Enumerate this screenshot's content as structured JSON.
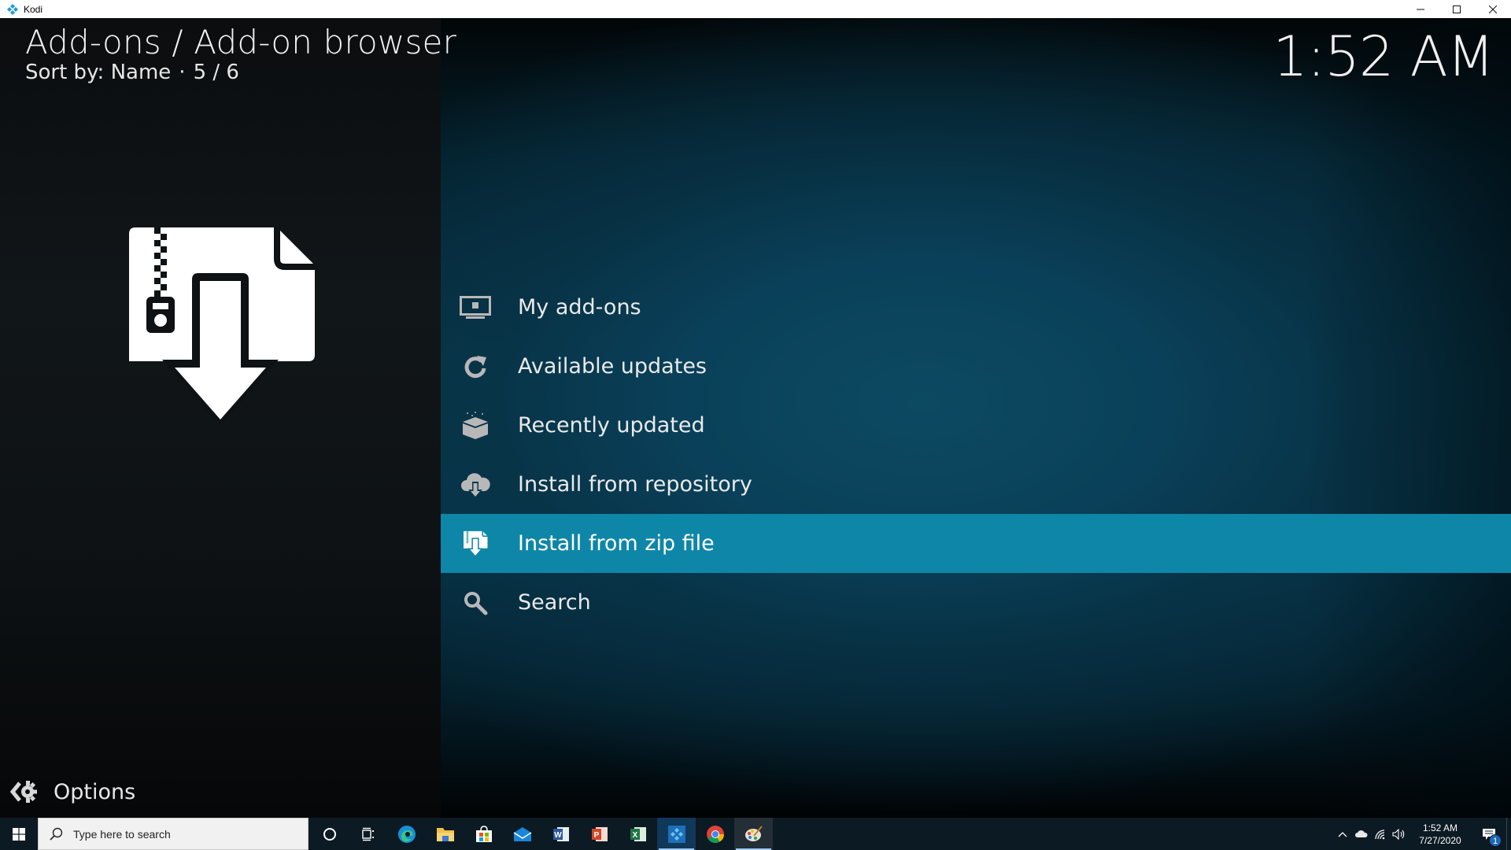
{
  "window": {
    "title": "Kodi",
    "app_icon": "kodi-logo-icon",
    "controls": {
      "minimize": "minimize-icon",
      "maximize": "maximize-icon",
      "close": "close-icon"
    }
  },
  "header": {
    "breadcrumb": "Add-ons / Add-on browser",
    "sort_label": "Sort by: Name",
    "separator": "·",
    "position": "5 / 6",
    "clock": "1:52 AM"
  },
  "preview": {
    "icon": "install-zip-icon"
  },
  "menu": {
    "selected_index": 4,
    "items": [
      {
        "label": "My add-ons",
        "icon": "monitor-addon-icon"
      },
      {
        "label": "Available updates",
        "icon": "refresh-icon"
      },
      {
        "label": "Recently updated",
        "icon": "open-box-icon"
      },
      {
        "label": "Install from repository",
        "icon": "cloud-download-icon"
      },
      {
        "label": "Install from zip file",
        "icon": "zip-download-icon"
      },
      {
        "label": "Search",
        "icon": "search-icon"
      }
    ]
  },
  "options": {
    "label": "Options",
    "icon": "options-gear-icon"
  },
  "colors": {
    "selected_row": "#0e86a8",
    "background_accent": "#0a4059",
    "text": "#eaeaea"
  },
  "taskbar": {
    "search_placeholder": "Type here to search",
    "apps": [
      {
        "name": "cortana",
        "icon": "cortana-icon"
      },
      {
        "name": "task-view",
        "icon": "task-view-icon"
      },
      {
        "name": "edge",
        "icon": "edge-icon"
      },
      {
        "name": "file-explorer",
        "icon": "folder-icon"
      },
      {
        "name": "store",
        "icon": "store-icon"
      },
      {
        "name": "mail",
        "icon": "mail-icon"
      },
      {
        "name": "word",
        "icon": "word-icon"
      },
      {
        "name": "powerpoint",
        "icon": "powerpoint-icon"
      },
      {
        "name": "excel",
        "icon": "excel-icon"
      },
      {
        "name": "kodi",
        "icon": "kodi-icon",
        "state": "active"
      },
      {
        "name": "chrome",
        "icon": "chrome-icon"
      },
      {
        "name": "paint",
        "icon": "paint-icon",
        "state": "running"
      }
    ],
    "tray": {
      "time": "1:52 AM",
      "date": "7/27/2020",
      "notification_count": "1"
    }
  }
}
